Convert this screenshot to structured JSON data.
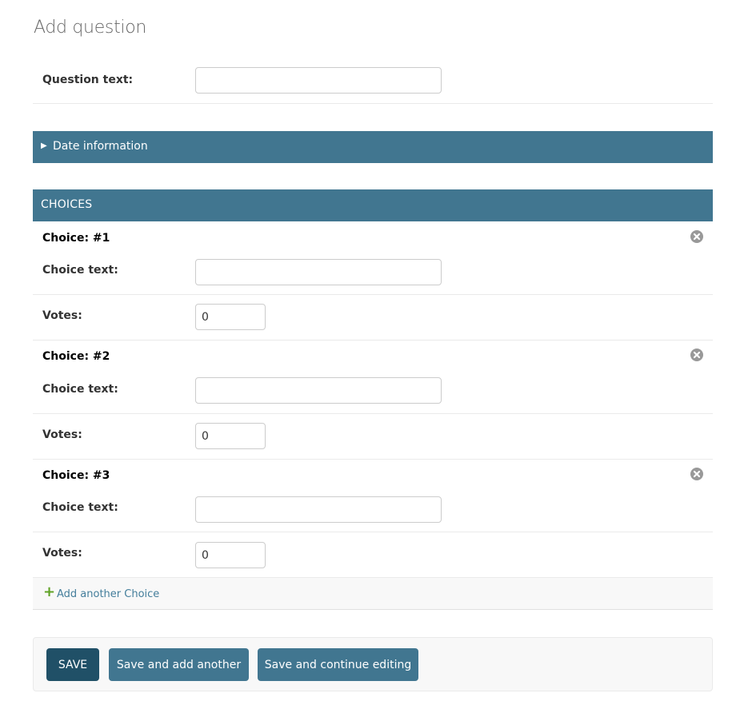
{
  "page": {
    "title": "Add question"
  },
  "question": {
    "label": "Question text:",
    "value": ""
  },
  "date_section": {
    "toggle_glyph": "▶",
    "label": "Date information"
  },
  "choices_section": {
    "header": "CHOICES",
    "items": [
      {
        "heading": "Choice: #1",
        "choice_text_label": "Choice text:",
        "choice_text_value": "",
        "votes_label": "Votes:",
        "votes_value": "0"
      },
      {
        "heading": "Choice: #2",
        "choice_text_label": "Choice text:",
        "choice_text_value": "",
        "votes_label": "Votes:",
        "votes_value": "0"
      },
      {
        "heading": "Choice: #3",
        "choice_text_label": "Choice text:",
        "choice_text_value": "",
        "votes_label": "Votes:",
        "votes_value": "0"
      }
    ],
    "add_icon": "plus-icon",
    "add_label": "Add another Choice",
    "delete_icon": "delete-icon"
  },
  "submit": {
    "save_label": "SAVE",
    "save_add_label": "Save and add another",
    "save_continue_label": "Save and continue editing"
  },
  "colors": {
    "module_header": "#417690",
    "primary_button": "#205067",
    "secondary_button": "#417690",
    "add_icon": "#5fa225",
    "link": "#447e9b",
    "delete_icon": "#999999"
  }
}
